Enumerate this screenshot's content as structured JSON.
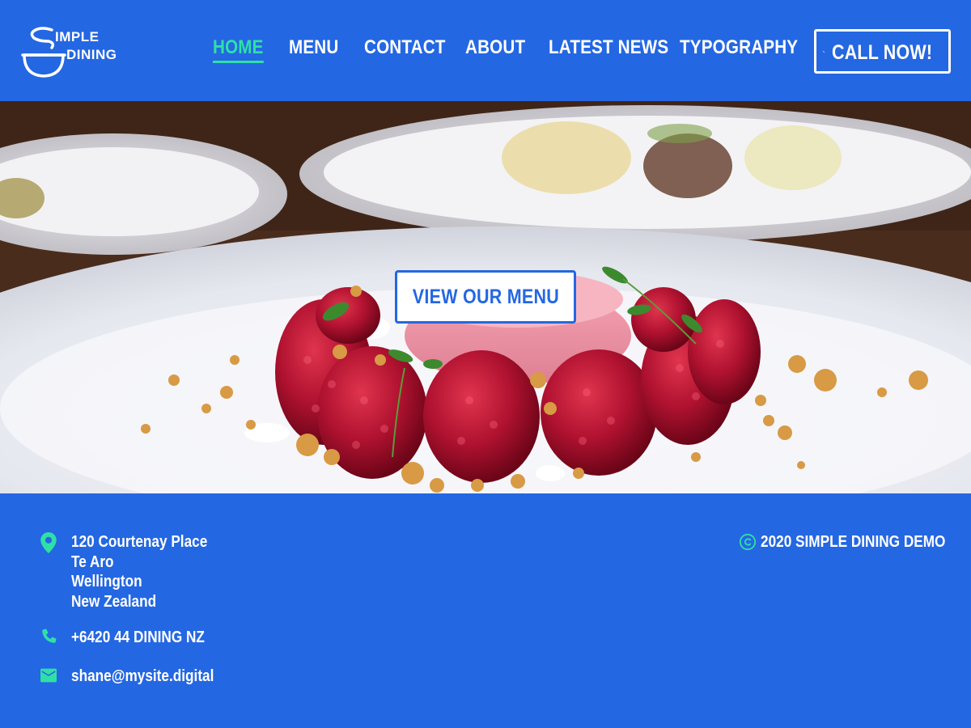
{
  "header": {
    "logo": {
      "line1": "IMPLE",
      "line2": "DINING"
    },
    "nav": [
      {
        "label": "HOME",
        "active": true
      },
      {
        "label": "MENU",
        "active": false
      },
      {
        "label": "CONTACT",
        "active": false
      },
      {
        "label": "ABOUT",
        "active": false
      },
      {
        "label": "LATEST NEWS",
        "active": false
      },
      {
        "label": "TYPOGRAPHY",
        "active": false
      }
    ],
    "call_button": {
      "label": "CALL NOW!",
      "icon": "phone-icon"
    }
  },
  "hero": {
    "cta_label": "VIEW OUR MENU"
  },
  "footer": {
    "address_lines": [
      "120 Courtenay Place",
      "Te Aro",
      "Wellington",
      "New Zealand"
    ],
    "phone": "+6420 44 DINING NZ",
    "email": "shane@mysite.digital",
    "copyright": "2020 SIMPLE DINING DEMO",
    "icons": {
      "address": "map-pin-icon",
      "phone": "phone-icon",
      "email": "email-icon",
      "copyright": "copyright-icon"
    }
  },
  "colors": {
    "brand_blue": "#2467e2",
    "accent_green": "#2fe0a6",
    "white": "#ffffff"
  }
}
